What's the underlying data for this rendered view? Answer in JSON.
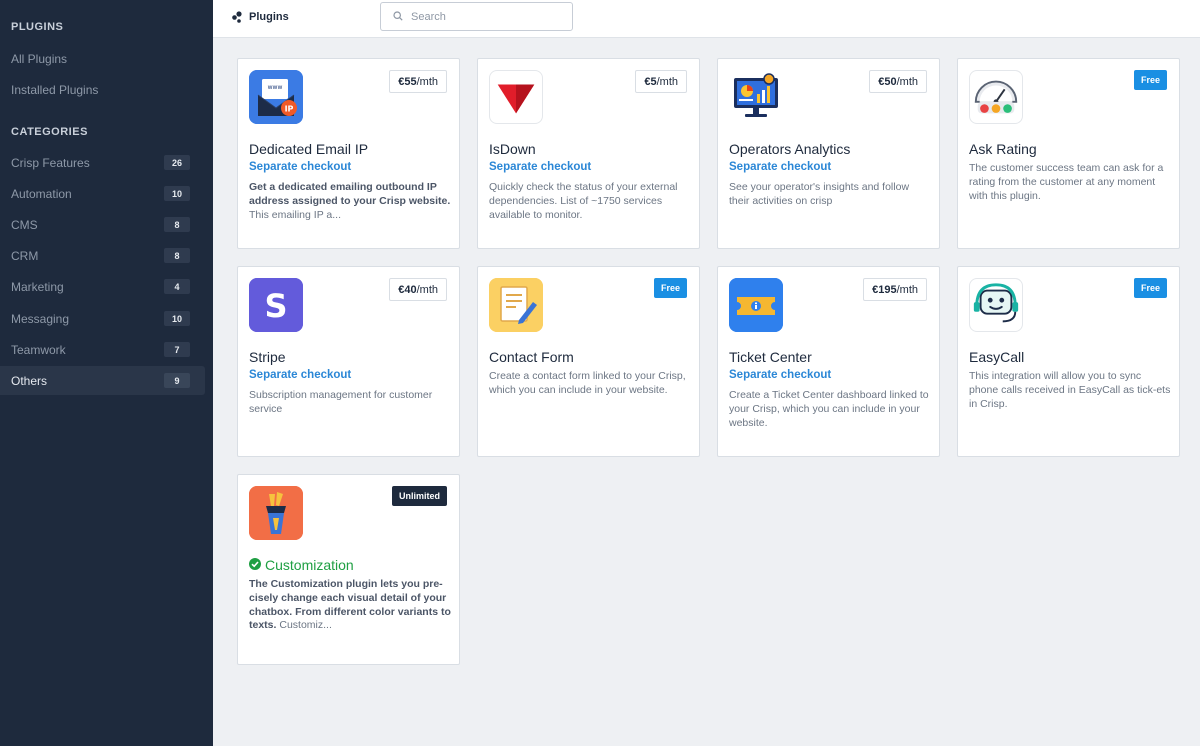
{
  "sidebar": {
    "plugins_heading": "PLUGINS",
    "links": [
      "All Plugins",
      "Installed Plugins"
    ],
    "categories_heading": "CATEGORIES",
    "categories": [
      {
        "label": "Crisp Features",
        "count": "26"
      },
      {
        "label": "Automation",
        "count": "10"
      },
      {
        "label": "CMS",
        "count": "8"
      },
      {
        "label": "CRM",
        "count": "8"
      },
      {
        "label": "Marketing",
        "count": "4"
      },
      {
        "label": "Messaging",
        "count": "10"
      },
      {
        "label": "Teamwork",
        "count": "7"
      },
      {
        "label": "Others",
        "count": "9",
        "active": true
      }
    ]
  },
  "topbar": {
    "title": "Plugins",
    "search_placeholder": "Search"
  },
  "plugins": [
    {
      "name": "Dedicated Email IP",
      "price_amount": "€55",
      "price_unit": "/mth",
      "checkout": "Separate checkout",
      "desc_bold": "Get a dedicated emailing outbound IP address assigned to your Crisp website.",
      "desc": " This emailing IP a...",
      "icon": "email-ip-icon"
    },
    {
      "name": "IsDown",
      "price_amount": "€5",
      "price_unit": "/mth",
      "checkout": "Separate checkout",
      "desc": "Quickly check the status of your external dependencies. List of ~1750 services available to monitor.",
      "icon": "isdown-icon"
    },
    {
      "name": "Operators Analytics",
      "price_amount": "€50",
      "price_unit": "/mth",
      "checkout": "Separate checkout",
      "desc": "See your operator's insights and follow their activities on crisp",
      "icon": "analytics-icon"
    },
    {
      "name": "Ask Rating",
      "badge": "Free",
      "desc": "The customer success team can ask for a rating from the customer at any moment with this plugin.",
      "icon": "rating-gauge-icon"
    },
    {
      "name": "Stripe",
      "price_amount": "€40",
      "price_unit": "/mth",
      "checkout": "Separate checkout",
      "desc": "Subscription management for customer service",
      "icon": "stripe-icon"
    },
    {
      "name": "Contact Form",
      "badge": "Free",
      "desc": "Create a contact form linked to your Crisp, which you can include in your website.",
      "icon": "contact-form-icon"
    },
    {
      "name": "Ticket Center",
      "price_amount": "€195",
      "price_unit": "/mth",
      "checkout": "Separate checkout",
      "desc": "Create a Ticket Center dashboard linked to your Crisp, which you can include in your website.",
      "icon": "ticket-icon"
    },
    {
      "name": "EasyCall",
      "badge": "Free",
      "desc": "This integration will allow you to sync phone calls received in EasyCall as tick-ets in Crisp.",
      "icon": "easycall-headset-icon"
    },
    {
      "name": "Customization",
      "badge": "Unlimited",
      "installed": true,
      "desc_bold": "The Customization plugin lets you pre-cisely change each visual detail of your chatbox. From different color variants to texts.",
      "desc": " Customiz...",
      "icon": "customization-brush-icon"
    }
  ],
  "colors": {
    "sidebar_bg": "#1e2a3d",
    "accent_blue": "#2b87d6",
    "free_badge": "#1a8fe3",
    "installed_green": "#1f9f43"
  }
}
